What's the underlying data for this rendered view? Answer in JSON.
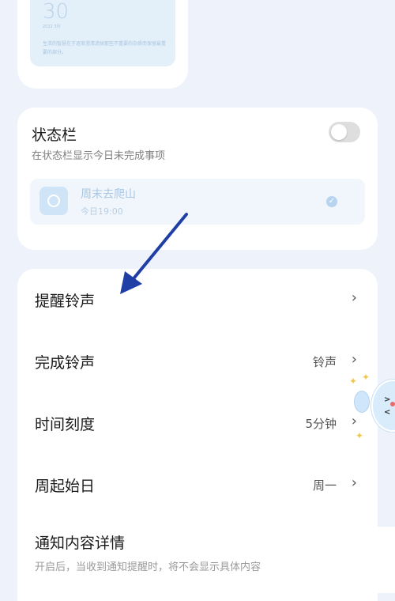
{
  "widget": {
    "date": "30",
    "sub": "2022 3月",
    "quote": "生活的智慧在于逐渐澄清滤掉那些不重要的杂质而保留最重要的部分。"
  },
  "status_bar": {
    "title": "状态栏",
    "description": "在状态栏显示今日未完成事项",
    "toggle_on": false,
    "preview": {
      "title": "周末去爬山",
      "time": "今日19:00"
    }
  },
  "settings": {
    "reminder_ringtone": {
      "label": "提醒铃声",
      "value": ""
    },
    "complete_ringtone": {
      "label": "完成铃声",
      "value": "铃声"
    },
    "time_scale": {
      "label": "时间刻度",
      "value": "5分钟"
    },
    "week_start": {
      "label": "周起始日",
      "value": "周一"
    },
    "notify_detail": {
      "label": "通知内容详情",
      "description": "开启后，当收到通知提醒时，将不会显示具体内容"
    },
    "chevron": "›"
  },
  "colors": {
    "background": "#eef3fb",
    "card": "#ffffff",
    "arrow": "#1f3fa6",
    "accent": "#b8d3ee"
  }
}
